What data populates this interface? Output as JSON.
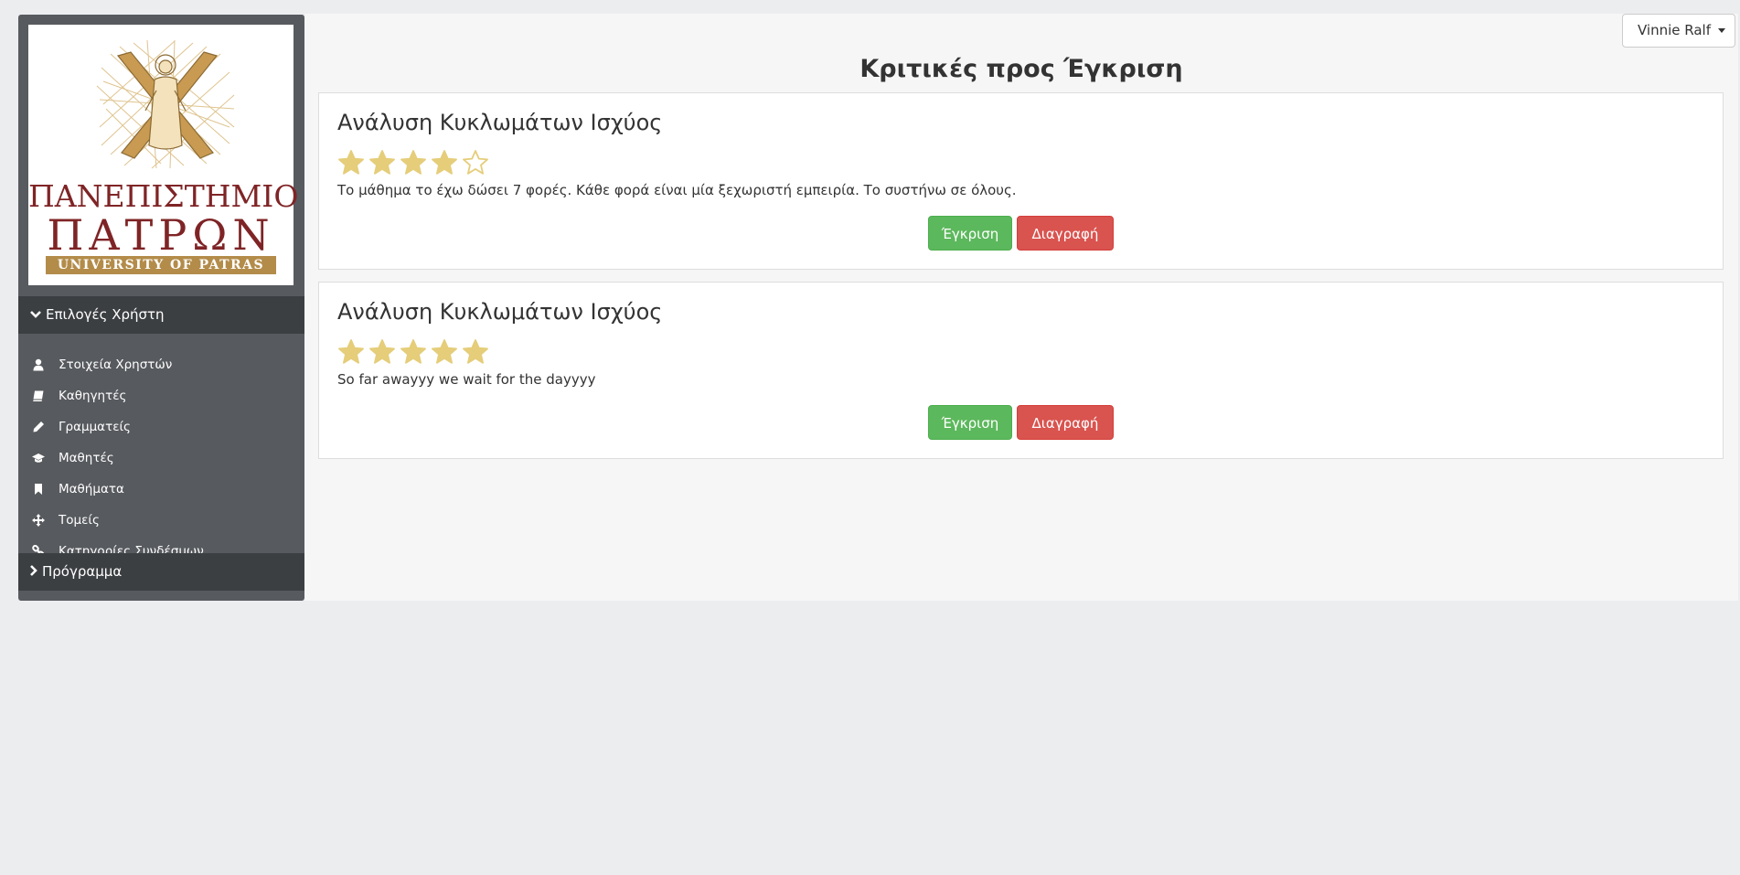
{
  "user_menu": {
    "name": "Vinnie Ralf"
  },
  "page": {
    "title": "Κριτικές προς Έγκριση"
  },
  "logo": {
    "line1": "ΠΑΝΕΠΙΣΤΗΜΙΟ",
    "line2": "ΠΑΤΡΩΝ",
    "line3": "UNIVERSITY OF PATRAS"
  },
  "sidebar": {
    "section_user": "Επιλογές Χρήστη",
    "items": [
      {
        "label": "Στοιχεία Χρηστών",
        "icon": "user-icon"
      },
      {
        "label": "Καθηγητές",
        "icon": "book-icon"
      },
      {
        "label": "Γραμματείς",
        "icon": "pencil-icon"
      },
      {
        "label": "Μαθητές",
        "icon": "graduation-cap-icon"
      },
      {
        "label": "Μαθήματα",
        "icon": "bookmark-icon"
      },
      {
        "label": "Τομείς",
        "icon": "move-arrows-icon"
      },
      {
        "label": "Κατηγορίες Συνδέσμων",
        "icon": "link-icon"
      }
    ],
    "section_program": "Πρόγραμμα"
  },
  "reviews": [
    {
      "title": "Ανάλυση Κυκλωμάτων Ισχύος",
      "rating": 4,
      "max_rating": 5,
      "text": "Το μάθημα το έχω δώσει 7 φορές. Κάθε φορά είναι μία ξεχωριστή εμπειρία. Το συστήνω σε όλους.",
      "approve_label": "Έγκριση",
      "delete_label": "Διαγραφή"
    },
    {
      "title": "Ανάλυση Κυκλωμάτων Ισχύος",
      "rating": 5,
      "max_rating": 5,
      "text": "So far awayyy we wait for the dayyyy",
      "approve_label": "Έγκριση",
      "delete_label": "Διαγραφή"
    }
  ],
  "colors": {
    "star": "#e5cd7a",
    "approve": "#5cb85c",
    "delete": "#d9534f",
    "sidebar": "#575a5e",
    "sidebar_header": "#3c3f42"
  }
}
